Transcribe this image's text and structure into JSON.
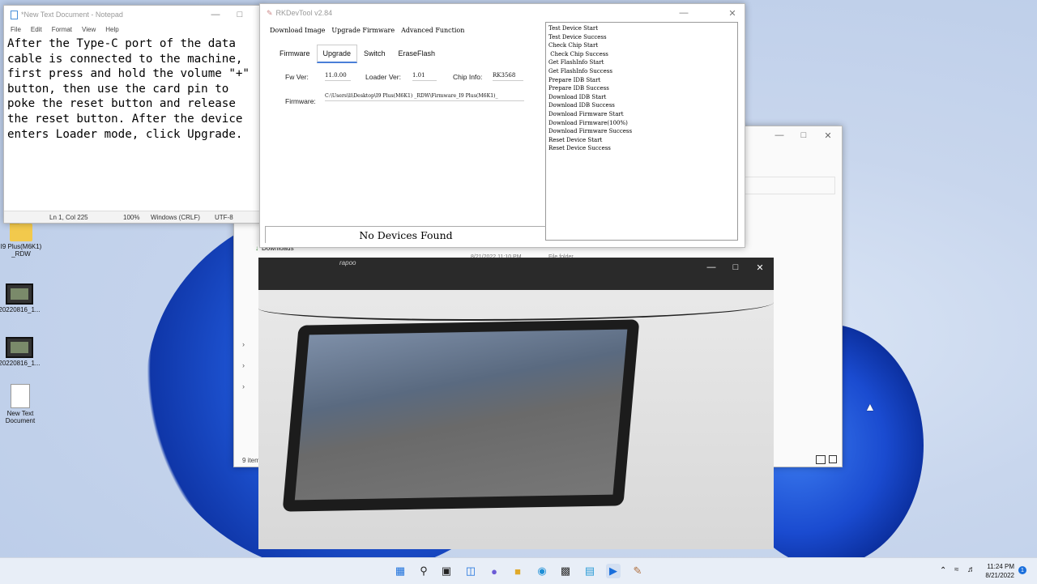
{
  "desktop": {
    "icons": [
      {
        "label": "I9 Plus(M6K1)\n_RDW",
        "kind": "folder"
      },
      {
        "label": "20220816_1...",
        "kind": "video"
      },
      {
        "label": "20220816_1...",
        "kind": "video"
      },
      {
        "label": "New Text\nDocument",
        "kind": "document"
      }
    ]
  },
  "notepad": {
    "title": "*New Text Document - Notepad",
    "menu": [
      "File",
      "Edit",
      "Format",
      "View",
      "Help"
    ],
    "text": "After the Type-C port of the data cable is connected to the machine, first press and hold the volume \"+\" button, then use the card pin to poke the reset button and release the reset button. After the device enters Loader mode, click Upgrade.",
    "status": {
      "position": "Ln 1, Col 225",
      "zoom": "100%",
      "line_ending": "Windows (CRLF)",
      "encoding": "UTF-8"
    }
  },
  "explorer": {
    "sidebar_item": "Downloads",
    "item_count": "9 item",
    "folder_row_date": "8/21/2022 11:10 PM",
    "folder_row_type": "File folder"
  },
  "rkdevtool": {
    "title": "RKDevTool v2.84",
    "tabs": [
      "Download Image",
      "Upgrade Firmware",
      "Advanced Function"
    ],
    "buttons": [
      "Firmware",
      "Upgrade",
      "Switch",
      "EraseFlash"
    ],
    "active_button": "Upgrade",
    "fw_ver_label": "Fw Ver:",
    "fw_ver": "11.0.00",
    "loader_ver_label": "Loader Ver:",
    "loader_ver": "1.01",
    "chip_info_label": "Chip Info:",
    "chip_info": "RK3568",
    "firmware_label": "Firmware:",
    "firmware_path": "C:\\Users\\li\\Desktop\\I9 Plus(M6K1) _RDW\\Firmware_I9 Plus(M6K1)_",
    "status": "No Devices Found",
    "log": [
      "Test Device Start",
      "Test Device Success",
      "Check Chip Start",
      " Check Chip Success",
      "Get FlashInfo Start",
      "Get FlashInfo Success",
      "Prepare IDB Start",
      "Prepare IDB Success",
      "Download IDB Start",
      "Download IDB Success",
      "Download Firmware Start",
      "Download Firmware(100%)",
      "Download Firmware Success",
      "Reset Device Start",
      "Reset Device Success"
    ]
  },
  "video": {
    "brand": "rapoo"
  },
  "taskbar": {
    "time": "11:24 PM",
    "date": "8/21/2022",
    "notification_count": "1",
    "apps": [
      "start-icon",
      "search-icon",
      "task-view-icon",
      "widgets-icon",
      "chat-icon",
      "file-explorer-icon",
      "edge-icon",
      "store-icon",
      "notepad-icon",
      "media-player-icon",
      "rkdevtool-icon"
    ]
  }
}
